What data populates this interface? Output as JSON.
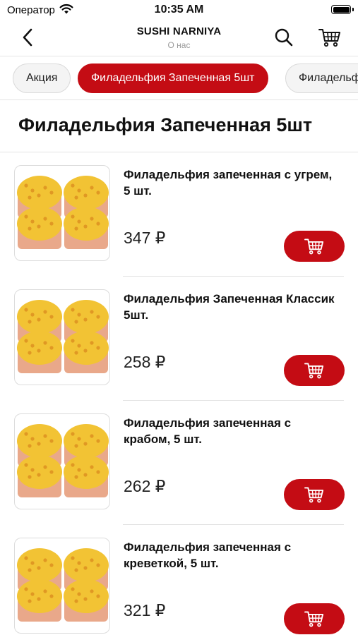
{
  "status_bar": {
    "carrier": "Оператор",
    "time": "10:35 AM",
    "battery_level": 1.0
  },
  "nav": {
    "title": "SUSHI NARNIYA",
    "subtitle": "О нас",
    "icons": [
      "chevron-left-icon",
      "search-icon",
      "cart-icon"
    ]
  },
  "tabs": [
    {
      "label": "Акция",
      "active": false
    },
    {
      "label": "Филадельфия Запеченная 5шт",
      "active": true
    },
    {
      "label": "Филадельфия",
      "active": false
    }
  ],
  "section": {
    "title": "Филадельфия Запеченная 5шт"
  },
  "products": [
    {
      "name": "Филадельфия запеченная с угрем, 5 шт.",
      "price": "347 ₽"
    },
    {
      "name": "Филадельфия Запеченная Классик 5шт.",
      "price": "258 ₽"
    },
    {
      "name": "Филадельфия запеченная с крабом, 5 шт.",
      "price": "262 ₽"
    },
    {
      "name": "Филадельфия запеченная с креветкой, 5 шт.",
      "price": "321 ₽"
    }
  ],
  "colors": {
    "accent": "#c40c14",
    "tab_inactive_bg": "#f4f4f4",
    "divider": "#e4e4e4"
  }
}
